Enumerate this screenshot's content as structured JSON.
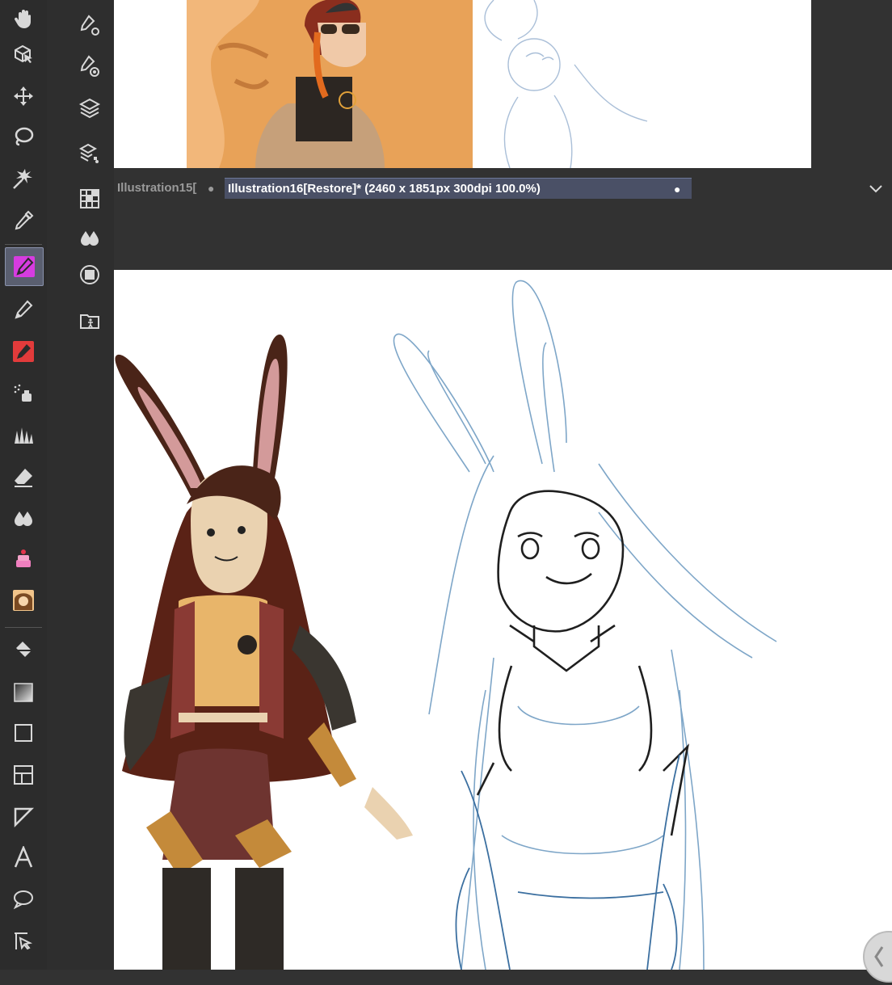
{
  "tabs": {
    "inactive_label": "Illustration15[",
    "active_label": "Illustration16[Restore]* (2460 x 1851px 300dpi 100.0%)",
    "dot": "●"
  },
  "toolbar": {
    "tools": [
      "hand-icon",
      "object-select-icon",
      "move-icon",
      "lasso-icon",
      "magic-wand-icon",
      "eyedropper-icon",
      "pen-icon",
      "pencil-icon",
      "marker-icon",
      "airbrush-icon",
      "decoration-icon",
      "eraser-icon",
      "blend-icon",
      "cake-brush-icon",
      "avatar-brush-icon",
      "fill-icon",
      "gradient-icon",
      "rectangle-icon",
      "frame-icon",
      "ruler-icon",
      "text-icon",
      "balloon-icon",
      "correct-line-icon"
    ],
    "active_tool": "pen-icon"
  },
  "palette_bar": [
    "tool-property-icon",
    "brush-size-icon",
    "layer-icon",
    "layer-property-icon",
    "color-set-icon",
    "color-wheel-icon",
    "sub-tool-icon",
    "material-icon"
  ],
  "colors": {
    "ui_dark": "#323232",
    "tab_active": "#4a5066",
    "active_tool_bg": "#5a5f70",
    "pen_highlight": "#d63ce0"
  }
}
